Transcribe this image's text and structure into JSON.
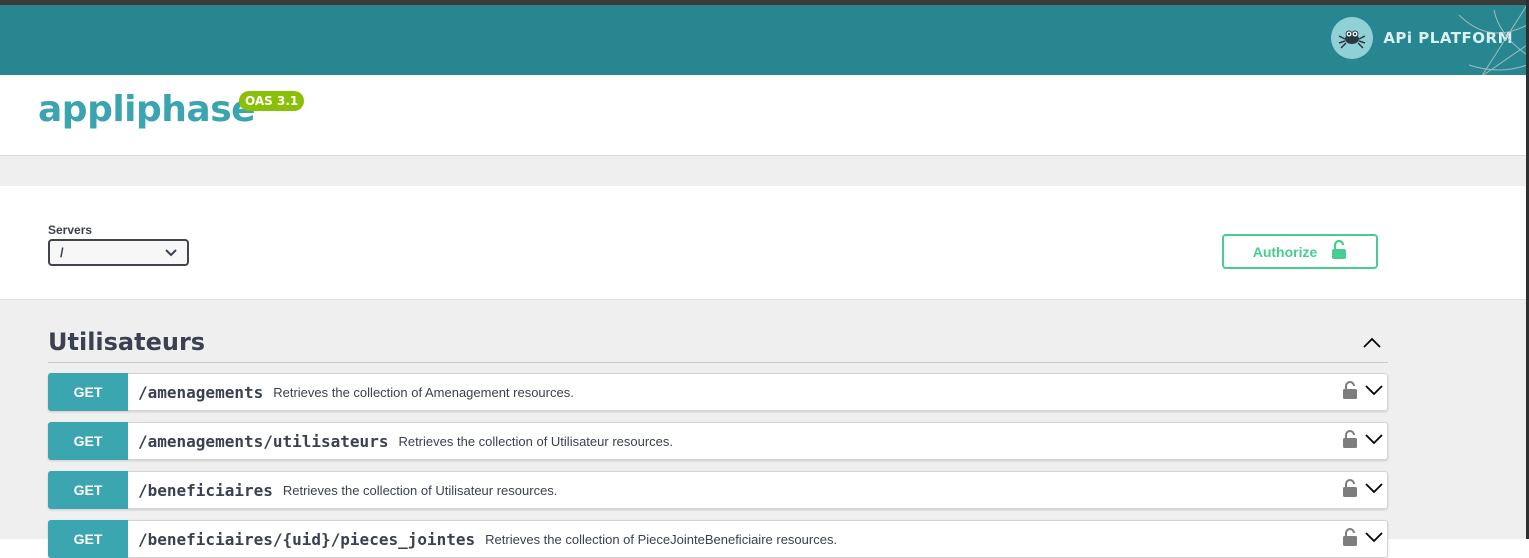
{
  "header": {
    "brand_text": "APi PLATFORM",
    "brand_icon": "spider-logo-icon",
    "bar_color": "#288690"
  },
  "info": {
    "title": "appliphase",
    "version_badge": "OAS 3.1"
  },
  "servers": {
    "label": "Servers",
    "selected": "/"
  },
  "authorize": {
    "label": "Authorize",
    "icon": "lock-open-icon",
    "color": "#49cc90"
  },
  "tag": {
    "title": "Utilisateurs",
    "operations": [
      {
        "method": "GET",
        "path": "/amenagements",
        "summary": "Retrieves the collection of Amenagement resources."
      },
      {
        "method": "GET",
        "path": "/amenagements/utilisateurs",
        "summary": "Retrieves the collection of Utilisateur resources."
      },
      {
        "method": "GET",
        "path": "/beneficiaires",
        "summary": "Retrieves the collection of Utilisateur resources."
      },
      {
        "method": "GET",
        "path": "/beneficiaires/{uid}/pieces_jointes",
        "summary": "Retrieves the collection of PieceJointeBeneficiaire resources."
      }
    ]
  }
}
